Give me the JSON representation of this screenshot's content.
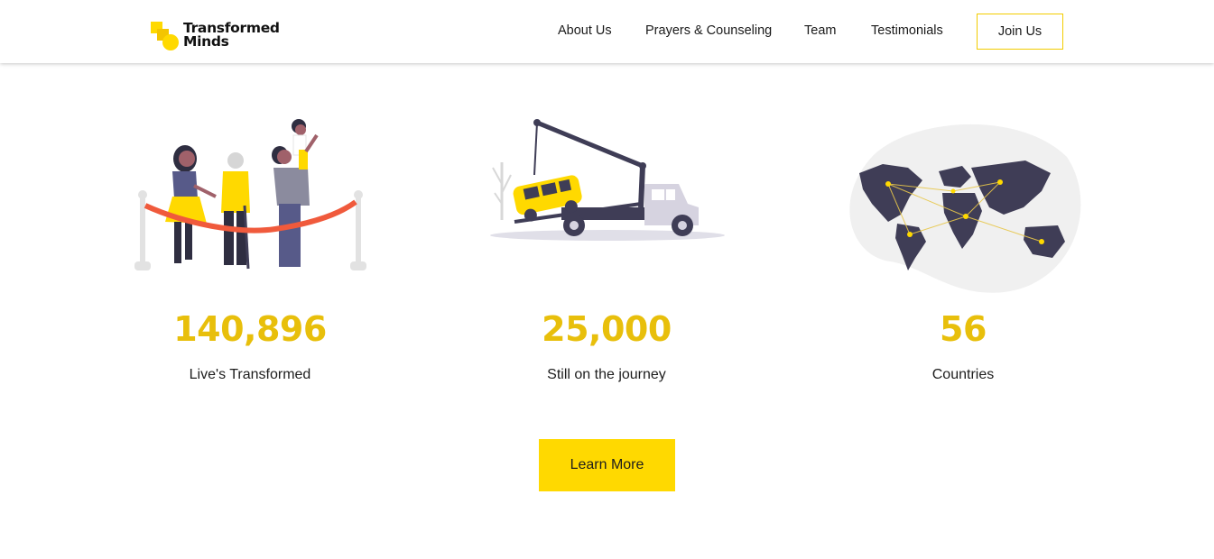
{
  "nav": {
    "logo_line1": "Transformed",
    "logo_line2": "Minds",
    "links": [
      "About Us",
      "Prayers & Counseling",
      "Team",
      "Testimonials"
    ],
    "cta": "Join Us"
  },
  "stats": [
    {
      "value": "140,896",
      "label": "Live's Transformed",
      "illustration": "ribbon-cutting-family-illustration"
    },
    {
      "value": "25,000",
      "label": "Still on the journey",
      "illustration": "tow-truck-illustration"
    },
    {
      "value": "56",
      "label": "Countries",
      "illustration": "world-map-illustration"
    }
  ],
  "cta": {
    "label": "Learn More"
  },
  "colors": {
    "accent": "#ffd900",
    "number": "#e8bf0b",
    "ribbon": "#f05a3c",
    "dark": "#3f3d56",
    "light": "#f0f0f0"
  }
}
